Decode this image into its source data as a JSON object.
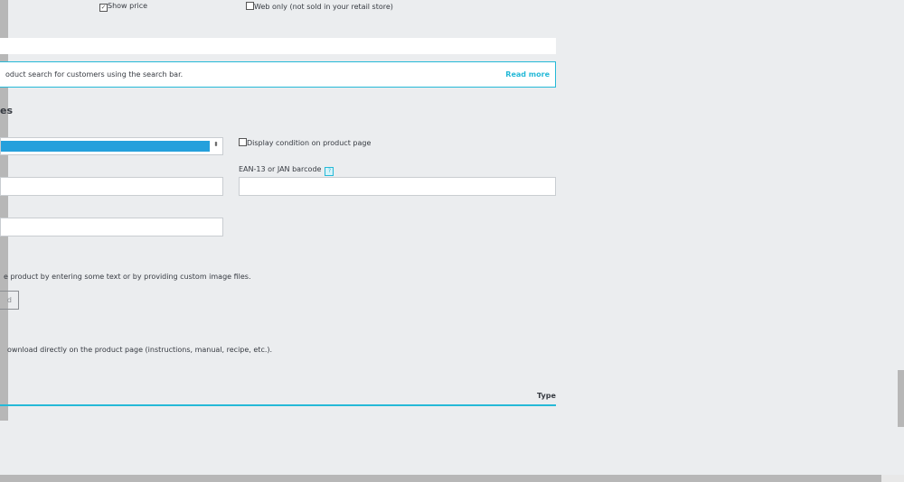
{
  "options": {
    "show_price": {
      "label": "Show price",
      "checked": true
    },
    "web_only": {
      "label": "Web only (not sold in your retail store)",
      "checked": false
    }
  },
  "search_alert": {
    "text": "oduct search for customers using the search bar.",
    "link": "Read more"
  },
  "section_title": "es",
  "condition": {
    "display_label": "Display condition on product page",
    "checked": false,
    "arrow": "⬍"
  },
  "ean": {
    "label": "EAN-13 or JAN barcode",
    "help": "?"
  },
  "customization": {
    "text": "e product by entering some text or by providing custom image files.",
    "button": "d"
  },
  "attached_files": {
    "text": "ownload directly on the product page (instructions, manual, recipe, etc.).",
    "column_type": "Type"
  },
  "colors": {
    "accent": "#25b9d7",
    "select_fill": "#25a0dc",
    "background": "#ebedef"
  }
}
